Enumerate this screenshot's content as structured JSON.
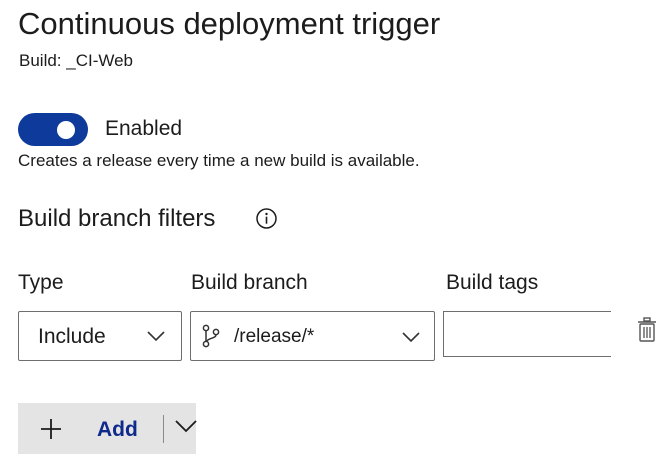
{
  "header": {
    "title": "Continuous deployment trigger",
    "build_label": "Build: _CI-Web"
  },
  "trigger": {
    "enabled": true,
    "toggle_label": "Enabled",
    "description": "Creates a release every time a new build is available."
  },
  "filters": {
    "section_title": "Build branch filters",
    "info_icon": "info-icon",
    "columns": {
      "type": "Type",
      "branch": "Build branch",
      "tags": "Build tags"
    },
    "row": {
      "type_value": "Include",
      "branch_value": "/release/*",
      "tags_value": ""
    },
    "add_button": {
      "label": "Add"
    }
  },
  "colors": {
    "toggle_on": "#0e3b9b",
    "add_label": "#0f2a8c",
    "add_background": "#e4e4e4"
  }
}
